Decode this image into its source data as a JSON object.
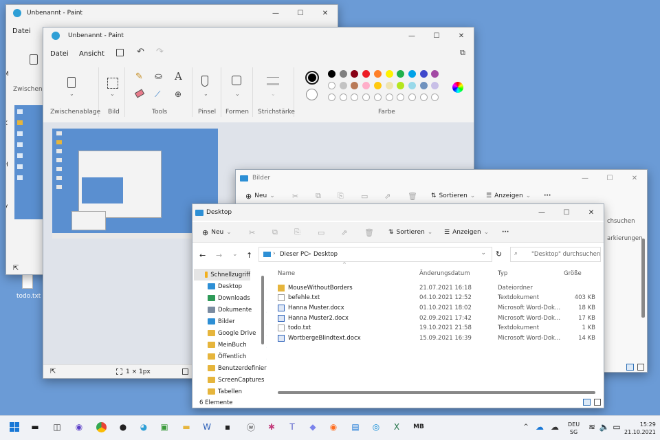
{
  "desktop": {
    "file_label": "todo.txt"
  },
  "paint_back": {
    "title": "Unbenannt - Paint",
    "menu_file": "Datei",
    "clip_label": "Zwischenablage",
    "side_letters": [
      "M",
      "K",
      "H",
      "V"
    ]
  },
  "paint": {
    "title": "Unbenannt - Paint",
    "menu": [
      "Datei",
      "Ansicht"
    ],
    "groups": [
      "Zwischenablage",
      "Bild",
      "Tools",
      "Pinsel",
      "Formen",
      "Strichstärke",
      "Farbe"
    ],
    "status_size": "1 × 1px"
  },
  "colors": {
    "row1": [
      "#000000",
      "#7f7f7f",
      "#880015",
      "#ed1c24",
      "#ff7f27",
      "#fff200",
      "#22b14c",
      "#00a2e8",
      "#3f48cc",
      "#a349a4"
    ],
    "row2": [
      "#ffffff",
      "#c3c3c3",
      "#b97a57",
      "#ffaec9",
      "#ffc90e",
      "#efe4b0",
      "#b5e61d",
      "#99d9ea",
      "#7092be",
      "#c8bfe7"
    ]
  },
  "explorer_back": {
    "title": "Bilder",
    "new": "Neu",
    "sort": "Sortieren",
    "view": "Anzeigen",
    "search_fragment": "chsuchen",
    "tag_fragment": "arkierungen"
  },
  "explorer": {
    "title": "Desktop",
    "new": "Neu",
    "sort": "Sortieren",
    "view": "Anzeigen",
    "more": "···",
    "breadcrumb": [
      "Dieser PC",
      ">",
      "Desktop"
    ],
    "search_placeholder": "\"Desktop\" durchsuchen",
    "columns": [
      "Name",
      "Änderungsdatum",
      "Typ",
      "Größe"
    ],
    "nav": [
      {
        "label": "Schnellzugriff",
        "pin": false
      },
      {
        "label": "Desktop",
        "pin": true
      },
      {
        "label": "Downloads",
        "pin": true
      },
      {
        "label": "Dokumente",
        "pin": true
      },
      {
        "label": "Bilder",
        "pin": true
      },
      {
        "label": "Google Drive",
        "pin": true
      },
      {
        "label": "MeinBuch",
        "pin": true
      },
      {
        "label": "Öffentlich",
        "pin": true
      },
      {
        "label": "Benutzerdefinier",
        "pin": false
      },
      {
        "label": "ScreenCaptures",
        "pin": false
      },
      {
        "label": "Tabellen",
        "pin": false
      }
    ],
    "files": [
      {
        "name": "MouseWithoutBorders",
        "date": "21.07.2021 16:18",
        "type": "Dateiordner",
        "size": "",
        "kind": "folder"
      },
      {
        "name": "befehle.txt",
        "date": "04.10.2021 12:52",
        "type": "Textdokument",
        "size": "403 KB",
        "kind": "txt"
      },
      {
        "name": "Hanna Muster.docx",
        "date": "01.10.2021 18:02",
        "type": "Microsoft Word-Dok...",
        "size": "18 KB",
        "kind": "doc"
      },
      {
        "name": "Hanna Muster2.docx",
        "date": "02.09.2021 17:42",
        "type": "Microsoft Word-Dok...",
        "size": "17 KB",
        "kind": "doc"
      },
      {
        "name": "todo.txt",
        "date": "19.10.2021 21:58",
        "type": "Textdokument",
        "size": "1 KB",
        "kind": "txt"
      },
      {
        "name": "WortbergeBlindtext.docx",
        "date": "15.09.2021 16:39",
        "type": "Microsoft Word-Dok...",
        "size": "14 KB",
        "kind": "doc"
      }
    ],
    "status": "6 Elemente"
  },
  "taskbar": {
    "lang": "DEU",
    "region": "SG",
    "time": "15:29",
    "date": "21.10.2021"
  }
}
